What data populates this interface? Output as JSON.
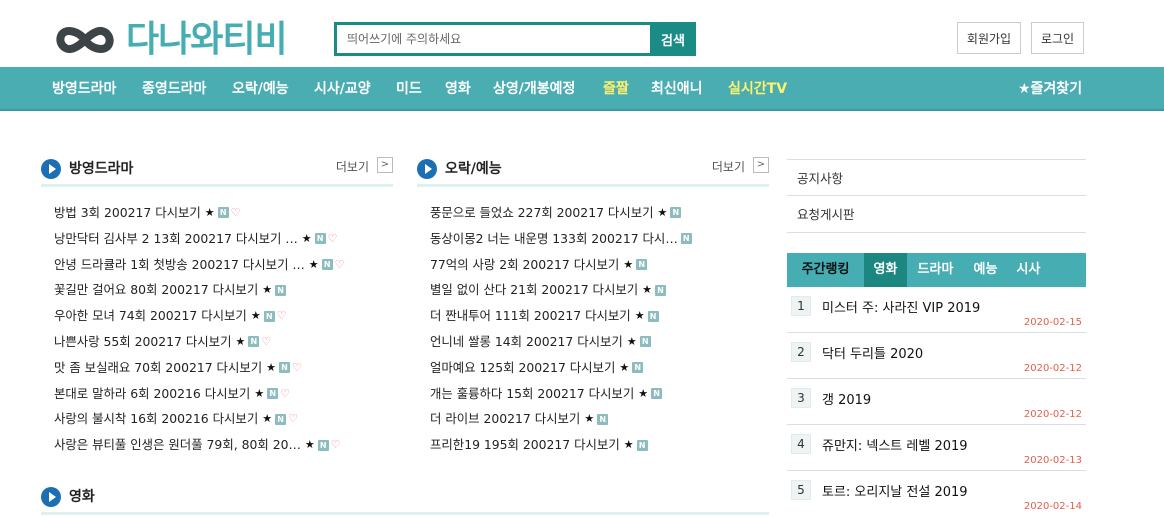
{
  "header": {
    "logo_text": "다나와티비",
    "search_placeholder": "띄어쓰기에 주의하세요",
    "search_button": "검색",
    "join_button": "회원가입",
    "login_button": "로그인"
  },
  "nav": {
    "items": [
      "방영드라마",
      "종영드라마",
      "오락/예능",
      "시사/교양",
      "미드",
      "영화",
      "상영/개봉예정",
      "즐짤",
      "최신애니",
      "실시간TV"
    ],
    "highlighted": [
      "즐짤",
      "실시간TV"
    ],
    "favorites": "★즐겨찾기"
  },
  "sections": {
    "drama": {
      "title": "방영드라마",
      "more": "더보기",
      "more_icon": "chevron-right-icon",
      "items": [
        {
          "title": "방법 3회 200217 다시보기",
          "heart": true
        },
        {
          "title": "낭만닥터 김사부 2 13회 200217 다시보기 …",
          "heart": true
        },
        {
          "title": "안녕 드라큘라 1회 첫방송 200217 다시보기 …",
          "heart": true
        },
        {
          "title": "꽃길만 걸어요 80회 200217 다시보기",
          "heart": false
        },
        {
          "title": "우아한 모녀 74회 200217 다시보기",
          "heart": true
        },
        {
          "title": "나쁜사랑 55회 200217 다시보기",
          "heart": true
        },
        {
          "title": "맛 좀 보실래요 70회 200217 다시보기",
          "heart": true
        },
        {
          "title": "본대로 말하라 6회 200216 다시보기",
          "heart": true
        },
        {
          "title": "사랑의 불시착 16회 200216 다시보기",
          "heart": true
        },
        {
          "title": "사랑은 뷰티풀 인생은 원더풀 79회, 80회 20…",
          "heart": true
        }
      ]
    },
    "variety": {
      "title": "오락/예능",
      "more": "더보기",
      "more_icon": "chevron-right-icon",
      "items": [
        {
          "title": "풍문으로 들었쇼 227회 200217 다시보기",
          "star": true
        },
        {
          "title": "동상이몽2 너는 내운명 133회 200217 다시…",
          "star": false
        },
        {
          "title": "77억의 사랑 2회 200217 다시보기",
          "star": true
        },
        {
          "title": "별일 없이 산다 21회 200217 다시보기",
          "star": true
        },
        {
          "title": "더 짠내투어 111회 200217 다시보기",
          "star": true
        },
        {
          "title": "언니네 쌀롱 14회 200217 다시보기",
          "star": true
        },
        {
          "title": "얼마예요 125회 200217 다시보기",
          "star": true
        },
        {
          "title": "개는 훌륭하다 15회 200217 다시보기",
          "star": true
        },
        {
          "title": "더 라이브 200217 다시보기",
          "star": true
        },
        {
          "title": "프리한19 195회 200217 다시보기",
          "star": true
        }
      ]
    },
    "movie": {
      "title": "영화"
    }
  },
  "sidebar": {
    "notice": "공지사항",
    "request_board": "요청게시판",
    "ranking": {
      "label": "주간랭킹",
      "tabs": [
        "영화",
        "드라마",
        "예능",
        "시사"
      ],
      "active_tab": "영화",
      "items": [
        {
          "rank": "1",
          "title": "미스터 주: 사라진 VIP 2019",
          "date": "2020-02-15"
        },
        {
          "rank": "2",
          "title": "닥터 두리틀 2020",
          "date": "2020-02-12"
        },
        {
          "rank": "3",
          "title": "갱 2019",
          "date": "2020-02-12"
        },
        {
          "rank": "4",
          "title": "쥬만지: 넥스트 레벨 2019",
          "date": "2020-02-13"
        },
        {
          "rank": "5",
          "title": "토르: 오리지날 전설 2019",
          "date": "2020-02-14"
        }
      ]
    }
  },
  "badges": {
    "star": "★",
    "new": "N",
    "heart": "♡"
  },
  "colors": {
    "teal": "#4aadb2",
    "dark_teal": "#1b8b86",
    "nav_highlight": "#fff26a",
    "date": "#e0604a",
    "play_icon": "#1d6fb4",
    "heart": "#ff6f9a"
  }
}
